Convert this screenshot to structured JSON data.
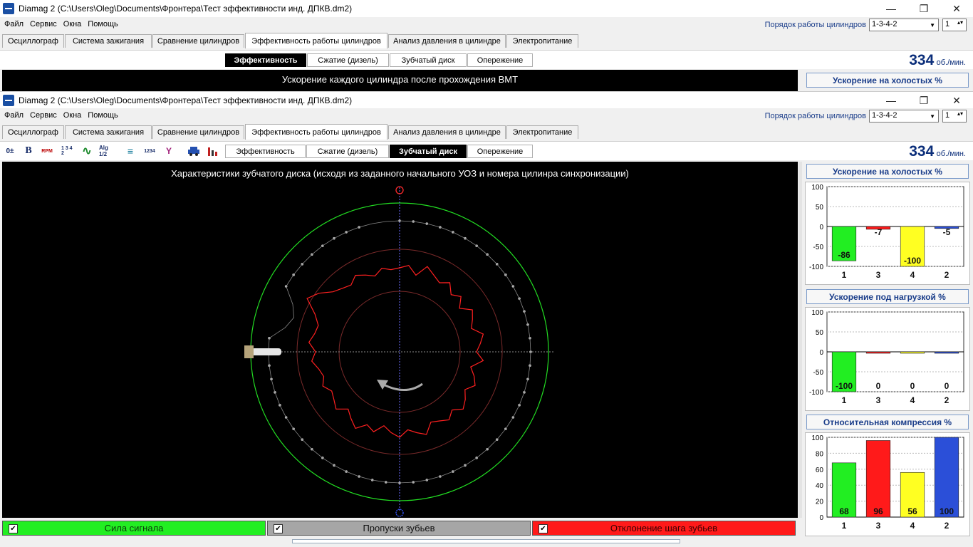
{
  "window": {
    "title": "Diamag 2 (C:\\Users\\Oleg\\Documents\\Фронтера\\Тест эффективности инд. ДПКВ.dm2)",
    "minimize": "—",
    "maximize": "❐",
    "close": "✕"
  },
  "menu": [
    "Файл",
    "Сервис",
    "Окна",
    "Помощь"
  ],
  "cyl_order_label": "Порядок работы цилиндров",
  "cyl_order_value": "1-3-4-2",
  "cyl_index_value": "1",
  "tabs": [
    "Осциллограф",
    "Система зажигания",
    "Сравнение цилиндров",
    "Эффективность работы цилиндров",
    "Анализ давления в цилиндре",
    "Электропитание"
  ],
  "subtabs": [
    "Эффективность",
    "Сжатие (дизель)",
    "Зубчатый диск",
    "Опережение"
  ],
  "toolbar_icons": {
    "zero": "0±",
    "bold": "B",
    "rpm": "RPM",
    "numbers": "1 3 4 2",
    "wave": "∿",
    "alg": "Alg 1/2",
    "sync": "≡",
    "step": "1234",
    "filter": "Y"
  },
  "rpm": {
    "value": "334",
    "unit": "об./мин."
  },
  "back_window": {
    "plot_title": "Ускорение каждого цилиндра после прохождения ВМТ",
    "side_header": "Ускорение на холостых %"
  },
  "front_window": {
    "plot_title": "Характеристики зубчатого диска (исходя из заданного начального УОЗ и номера цилинра синхронизации)"
  },
  "sidebar": {
    "idle_title": "Ускорение на холостых %",
    "load_title": "Ускорение под нагрузкой %",
    "comp_title": "Относительная компрессия %"
  },
  "checks": {
    "signal": "Сила сигнала",
    "missing": "Пропуски зубьев",
    "deviation": "Отклонение шага зубьев"
  },
  "colors": {
    "green": "#22ee22",
    "red": "#ff1a1a",
    "yellow": "#ffff22",
    "blue": "#2b4fd8",
    "grey": "#a6a6a6"
  },
  "chart_data": [
    {
      "type": "bar",
      "title": "Ускорение на холостых %",
      "categories": [
        "1",
        "3",
        "4",
        "2"
      ],
      "values": [
        -86,
        -7,
        -100,
        -5
      ],
      "colors": [
        "#22ee22",
        "#ff1a1a",
        "#ffff22",
        "#2b4fd8"
      ],
      "ylim": [
        -100,
        100
      ],
      "yticks": [
        "100",
        "50",
        "0",
        "-50",
        "-100"
      ]
    },
    {
      "type": "bar",
      "title": "Ускорение под нагрузкой %",
      "categories": [
        "1",
        "3",
        "4",
        "2"
      ],
      "values": [
        -100,
        0,
        0,
        0
      ],
      "colors": [
        "#22ee22",
        "#ff1a1a",
        "#ffff22",
        "#2b4fd8"
      ],
      "ylim": [
        -100,
        100
      ],
      "yticks": [
        "100",
        "50",
        "0",
        "-50",
        "-100"
      ]
    },
    {
      "type": "bar",
      "title": "Относительная компрессия %",
      "categories": [
        "1",
        "3",
        "4",
        "2"
      ],
      "values": [
        68,
        96,
        56,
        100
      ],
      "colors": [
        "#22ee22",
        "#ff1a1a",
        "#ffff22",
        "#2b4fd8"
      ],
      "ylim": [
        0,
        100
      ],
      "yticks": [
        "100",
        "80",
        "60",
        "40",
        "20",
        "0"
      ]
    }
  ]
}
